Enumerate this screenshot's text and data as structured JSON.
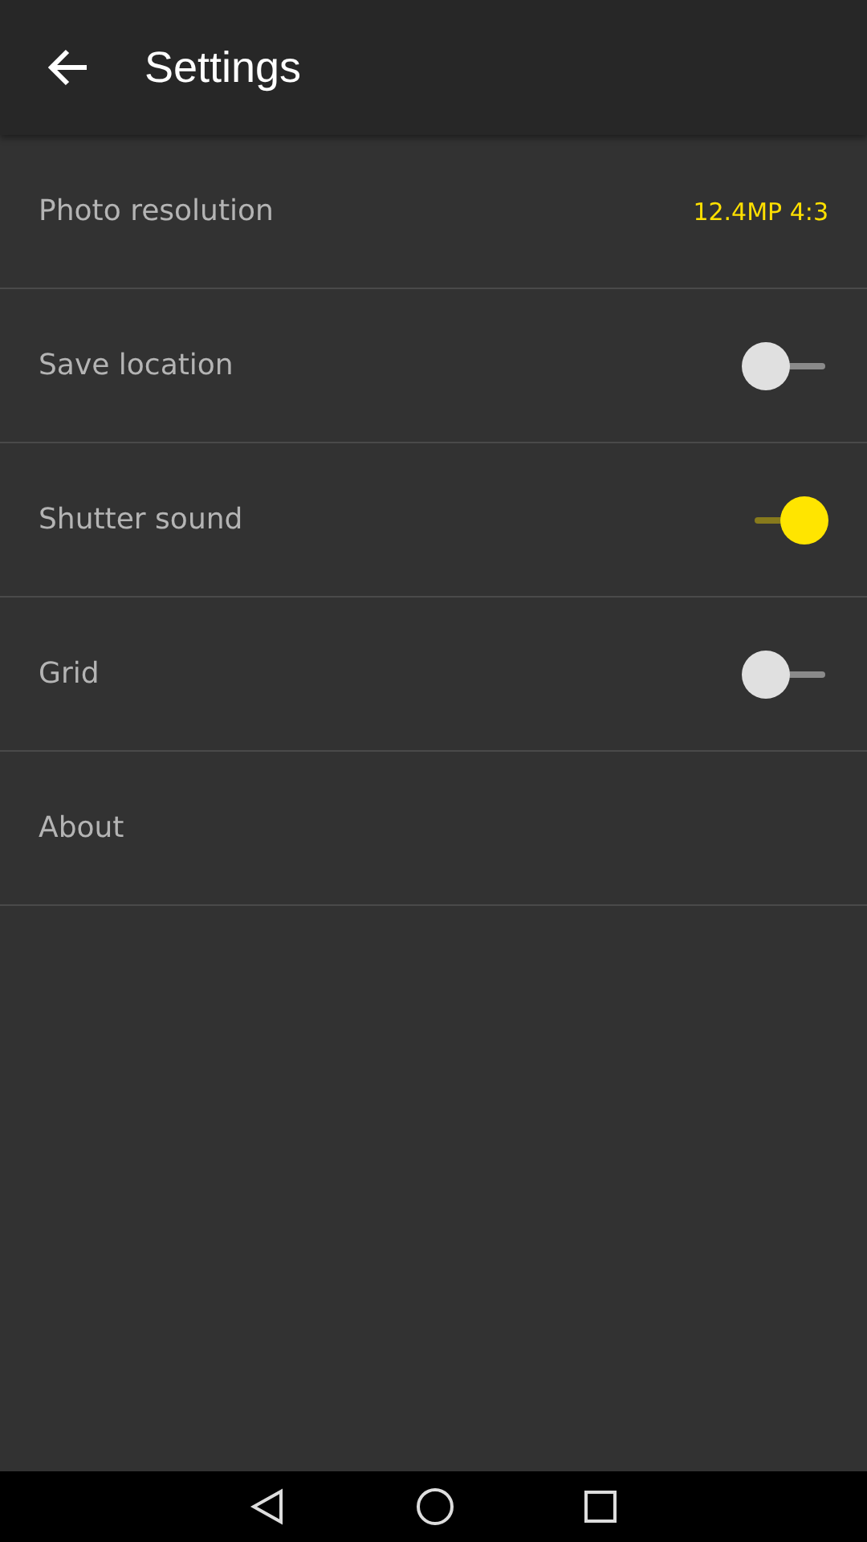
{
  "app_bar": {
    "title": "Settings"
  },
  "settings": [
    {
      "kind": "value",
      "label": "Photo resolution",
      "value": "12.4MP 4:3"
    },
    {
      "kind": "switch",
      "label": "Save location",
      "on": false
    },
    {
      "kind": "switch",
      "label": "Shutter sound",
      "on": true
    },
    {
      "kind": "switch",
      "label": "Grid",
      "on": false
    },
    {
      "kind": "plain",
      "label": "About"
    }
  ]
}
